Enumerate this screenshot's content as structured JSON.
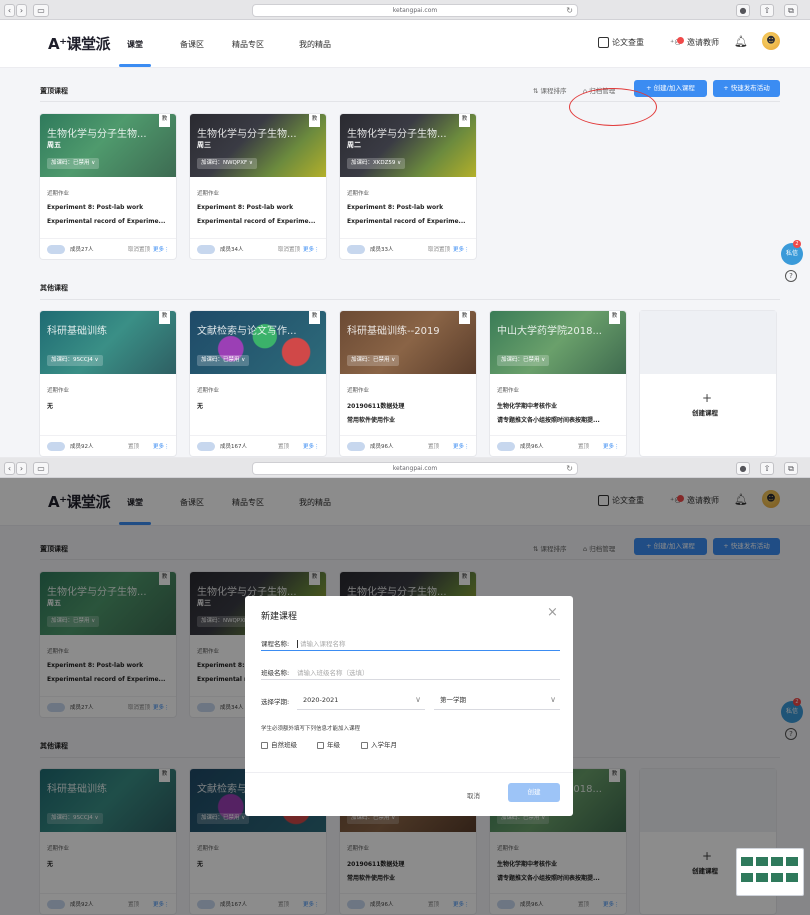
{
  "browser": {
    "url": "ketangpai.com",
    "nav_back": "‹",
    "nav_forward": "›",
    "sidebar_toggle": "▭",
    "reload": "↻"
  },
  "nav": {
    "logo": "A⁺课堂派",
    "items": [
      "课堂",
      "备课区",
      "精品专区",
      "我的精品"
    ],
    "active": "课堂",
    "paper_check": "论文查重",
    "invite": "邀请教师"
  },
  "pinned": {
    "title": "置顶课程",
    "sort": "课程排序",
    "archive": "归档管理",
    "create_join": "+ 创建/加入课程",
    "quick_publish": "+ 快速发布活动"
  },
  "others": {
    "title": "其他课程"
  },
  "pinned_cards": [
    {
      "title": "生物化学与分子生物...",
      "day": "周五",
      "code": "加课码：已禁用 ∨",
      "tag": "教",
      "sub": "近期作业",
      "hw1": "Experiment 8: Post-lab work",
      "hw2": "Experimental record of Experime...",
      "members": "成员27人",
      "pin": "取消置顶",
      "more": "更多⋮"
    },
    {
      "title": "生物化学与分子生物...",
      "day": "周三",
      "code": "加课码：NWQPXF ∨",
      "tag": "教",
      "sub": "近期作业",
      "hw1": "Experiment 8: Post-lab work",
      "hw2": "Experimental record of Experime...",
      "members": "成员34人",
      "pin": "取消置顶",
      "more": "更多⋮"
    },
    {
      "title": "生物化学与分子生物...",
      "day": "周二",
      "code": "加课码：XKDZ59 ∨",
      "tag": "教",
      "sub": "近期作业",
      "hw1": "Experiment 8: Post-lab work",
      "hw2": "Experimental record of Experime...",
      "members": "成员33人",
      "pin": "取消置顶",
      "more": "更多⋮"
    }
  ],
  "other_cards": [
    {
      "title": "科研基础训练",
      "code": "加课码：9SCCJ4 ∨",
      "tag": "教",
      "sub": "近期作业",
      "hw1": "无",
      "hw2": "",
      "members": "成员92人",
      "pin": "置顶",
      "more": "更多⋮"
    },
    {
      "title": "文献检索与论文写作...",
      "code": "加课码：已禁用 ∨",
      "tag": "教",
      "sub": "近期作业",
      "hw1": "无",
      "hw2": "",
      "members": "成员167人",
      "pin": "置顶",
      "more": "更多⋮"
    },
    {
      "title": "科研基础训练--2019",
      "code": "加课码：已禁用 ∨",
      "tag": "教",
      "sub": "近期作业",
      "hw1": "20190611数据处理",
      "hw2": "常用软件使用作业",
      "members": "成员96人",
      "pin": "置顶",
      "more": "更多⋮"
    },
    {
      "title": "中山大学药学院2018...",
      "code": "加课码：已禁用 ∨",
      "tag": "教",
      "sub": "近期作业",
      "hw1": "生物化学期中考核作业",
      "hw2": "请专题推文各小组按照时间表按期提...",
      "members": "成员96人",
      "pin": "置顶",
      "more": "更多⋮"
    }
  ],
  "create_card": {
    "plus": "+",
    "label": "创建课程"
  },
  "float": {
    "chat": "私信",
    "badge": "2",
    "help": "?"
  },
  "modal": {
    "title": "新建课程",
    "close": "×",
    "course_label": "课程名称:",
    "course_placeholder": "请输入课程名称",
    "class_label": "班级名称:",
    "class_placeholder": "请输入班级名称（选填）",
    "term_label": "选择学期:",
    "year": "2020-2021",
    "semester": "第一学期",
    "hint": "学生必须额外填写下列信息才能加入课程",
    "checks": [
      "自然班级",
      "年级",
      "入学年月"
    ],
    "cancel": "取消",
    "create": "创建"
  }
}
